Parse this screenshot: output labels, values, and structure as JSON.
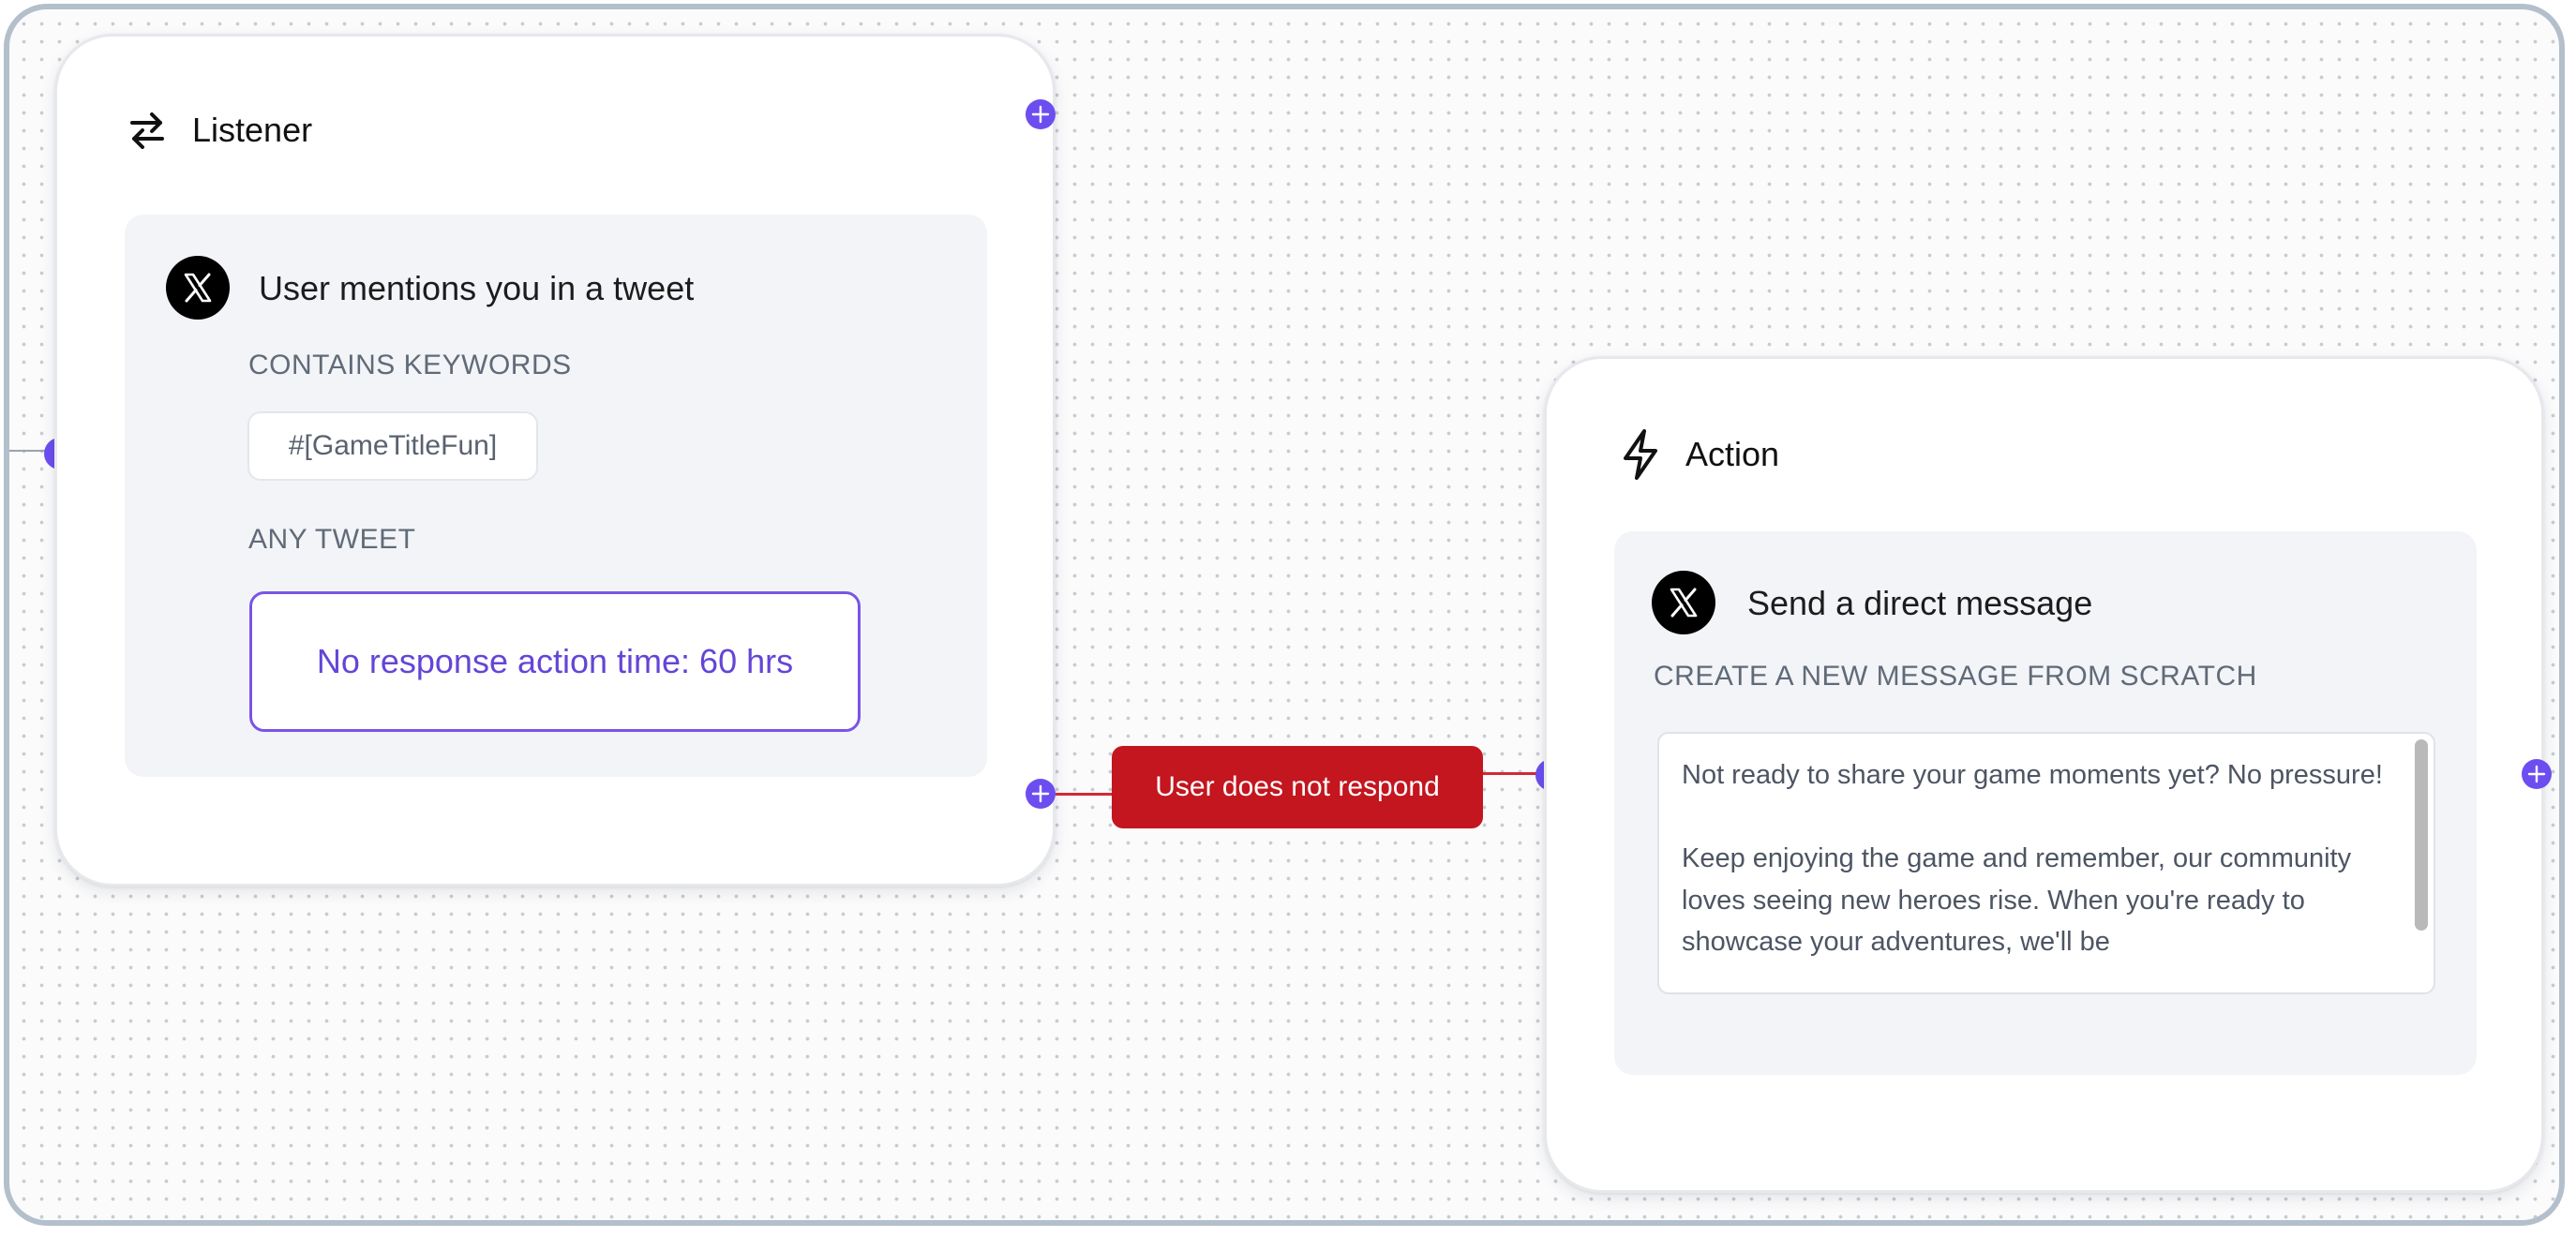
{
  "listener": {
    "title": "Listener",
    "trigger_title": "User mentions you in a tweet",
    "keywords_label": "CONTAINS KEYWORDS",
    "keyword_chip": "#[GameTitleFun]",
    "any_tweet_label": "ANY TWEET",
    "no_response_text": "No response action time: 60 hrs"
  },
  "edge": {
    "label": "User does not respond"
  },
  "action": {
    "title": "Action",
    "action_title": "Send a direct message",
    "create_label": "CREATE A NEW MESSAGE FROM SCRATCH",
    "message_text": "Not ready to share your game moments yet? No pressure!\n\nKeep enjoying the game and remember, our community loves seeing new heroes rise. When you're ready to showcase your adventures, we'll be"
  },
  "colors": {
    "accent": "#6c4ef0",
    "edge_red": "#c3161f",
    "purple_text": "#6446d6"
  },
  "icons": {
    "listener_icon": "swap-arrows-icon",
    "action_icon": "lightning-bolt-icon",
    "platform_icon": "x-logo-icon"
  }
}
